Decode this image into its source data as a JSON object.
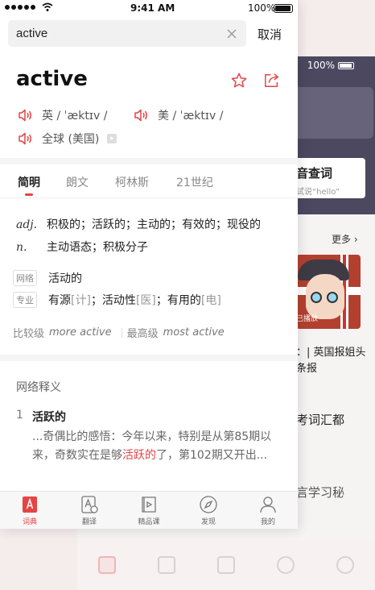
{
  "background_screen": {
    "battery_text": "100%",
    "voice_search_title": "音查词",
    "voice_search_hint": "试说“hello”",
    "more_label": "更多",
    "image_overlay": "已播放",
    "item1_text": "：| 英国报姐头条报",
    "item2_text": "考词汇都",
    "item3_text": "言学习秘"
  },
  "status_bar": {
    "time": "9:41 AM",
    "battery": "100%"
  },
  "search": {
    "value": "active",
    "cancel_label": "取消"
  },
  "word": {
    "title": "active",
    "uk_label": "英 / ˈæktɪv /",
    "us_label": "美 / ˈæktɪv /",
    "global_label": "全球 (美国)"
  },
  "tabs": [
    {
      "label": "简明"
    },
    {
      "label": "朗文"
    },
    {
      "label": "柯林斯"
    },
    {
      "label": "21世纪"
    }
  ],
  "definitions": [
    {
      "pos": "adj.",
      "text": "积极的；活跃的；主动的；有效的；现役的"
    },
    {
      "pos": "n.",
      "text": "主动语态；积极分子"
    }
  ],
  "web_tag": {
    "tag": "网络",
    "text": "活动的"
  },
  "pro_tag": {
    "tag": "专业",
    "part1": "有源",
    "field1": "[计]",
    "part2": "；活动性",
    "field2": "[医]",
    "part3": "；有用的",
    "field3": "[电]"
  },
  "comparison": {
    "comparative_label": "比较级",
    "comparative_value": "more active",
    "superlative_label": "最高级",
    "superlative_value": "most active"
  },
  "web_definitions": {
    "title": "网络释义",
    "number": "1",
    "word": "活跃的",
    "example_before": "...奇偶比的感悟：今年以来，特别是从第85期以来，奇数实在是够",
    "example_highlight": "活跃的",
    "example_after": "了，第102期又开出..."
  },
  "tabbar": [
    {
      "label": "词典",
      "icon": "dictionary-icon"
    },
    {
      "label": "翻译",
      "icon": "translate-icon"
    },
    {
      "label": "精品课",
      "icon": "course-icon"
    },
    {
      "label": "发现",
      "icon": "compass-icon"
    },
    {
      "label": "我的",
      "icon": "user-icon"
    }
  ],
  "colors": {
    "accent": "#e54444",
    "header_dark": "#4b4860"
  }
}
